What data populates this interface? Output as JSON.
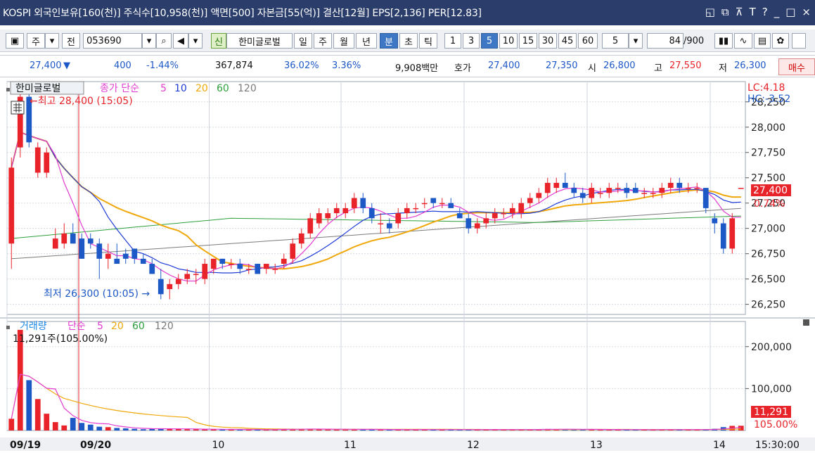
{
  "title": {
    "text": "KOSPI 외국인보유[160(천)] 주식수[10,958(천)] 액면[500] 자본금[55(억)] 결산[12월] EPS[2,136] PER[12.83]",
    "controls": [
      "?",
      "_",
      "□",
      "×"
    ]
  },
  "toolbar": {
    "market": "주",
    "category": "전",
    "code": "053690",
    "stock_name": "한미글로벌",
    "shin": "신",
    "periods": [
      "일",
      "주",
      "월",
      "년",
      "분",
      "초",
      "틱"
    ],
    "active_period": "분",
    "intervals": [
      "1",
      "3",
      "5",
      "10",
      "15",
      "30",
      "45",
      "60"
    ],
    "active_interval": "5",
    "interval_value": "5",
    "count": "84",
    "count_total": "/900"
  },
  "quote": {
    "price": "27,400",
    "arrow": "▼",
    "change": "400",
    "change_pct": "-1.44%",
    "volume": "367,874",
    "vol_ratio": "36.02%",
    "turnover": "3.36%",
    "trade_amount": "9,908백만",
    "hoga_label": "호가",
    "ask": "27,400",
    "bid": "27,350",
    "open_label": "시",
    "open": "26,800",
    "high_label": "고",
    "high": "27,550",
    "low_label": "저",
    "low": "26,300",
    "buy_label": "매수"
  },
  "price_panel": {
    "legend": {
      "name": "한미글로벌",
      "ma_label": "종가 단순",
      "periods": [
        "5",
        "10",
        "20",
        "60",
        "120"
      ]
    },
    "max_note": "최고 28,400 (15:05)",
    "min_note": "최저 26,300 (10:05)",
    "lc": "LC:4.18",
    "hc": "HC:-3.52",
    "last_price": "27,400",
    "last_pct": "0.74%",
    "y_ticks": [
      "28,250",
      "28,000",
      "27,750",
      "27,500",
      "27,250",
      "27,000",
      "26,750",
      "26,500",
      "26,250"
    ],
    "y_values": [
      28250,
      28000,
      27750,
      27500,
      27250,
      27000,
      26750,
      26500,
      26250
    ]
  },
  "volume_panel": {
    "legend": {
      "name": "거래량",
      "ma_label": "단순",
      "periods": [
        "5",
        "20",
        "60",
        "120"
      ]
    },
    "note": "11,291주(105.00%)",
    "y_ticks": [
      "200,000",
      "100,000"
    ],
    "y_values": [
      200000,
      100000
    ],
    "last_value": "11,291",
    "last_pct": "105.00%"
  },
  "x_axis": {
    "labels": [
      "09/19",
      "09/20",
      "10",
      "11",
      "12",
      "13",
      "14",
      "15"
    ],
    "time": "15:30:00"
  },
  "colors": {
    "up": "#e8232a",
    "down": "#1d58c7",
    "ma5": "#e23bd1",
    "ma10": "#1e3ad6",
    "ma20": "#f0a80a",
    "ma60": "#2ca03c",
    "ma120": "#7a7a7a",
    "title_bg": "#2b3e6b"
  },
  "chart_data": {
    "type": "candlestick",
    "candles": [
      {
        "o": 26850,
        "h": 27700,
        "l": 26600,
        "c": 27600
      },
      {
        "o": 27800,
        "h": 28400,
        "l": 27700,
        "c": 28300
      },
      {
        "o": 28300,
        "h": 28400,
        "l": 27800,
        "c": 27850
      },
      {
        "o": 27550,
        "h": 27850,
        "l": 27500,
        "c": 27800
      },
      {
        "o": 27550,
        "h": 27800,
        "l": 27500,
        "c": 27750
      },
      {
        "o": 26800,
        "h": 27000,
        "l": 26800,
        "c": 26900
      },
      {
        "o": 26850,
        "h": 27050,
        "l": 26800,
        "c": 26950
      },
      {
        "o": 26950,
        "h": 27050,
        "l": 26850,
        "c": 26850
      },
      {
        "o": 26900,
        "h": 26950,
        "l": 26700,
        "c": 26700
      },
      {
        "o": 26900,
        "h": 26950,
        "l": 26800,
        "c": 26850
      },
      {
        "o": 26850,
        "h": 26900,
        "l": 26500,
        "c": 26700
      },
      {
        "o": 26700,
        "h": 26850,
        "l": 26600,
        "c": 26750
      },
      {
        "o": 26700,
        "h": 26850,
        "l": 26650,
        "c": 26650
      },
      {
        "o": 26750,
        "h": 26800,
        "l": 26650,
        "c": 26700
      },
      {
        "o": 26800,
        "h": 26800,
        "l": 26650,
        "c": 26700
      },
      {
        "o": 26700,
        "h": 26750,
        "l": 26650,
        "c": 26650
      },
      {
        "o": 26650,
        "h": 26700,
        "l": 26550,
        "c": 26550
      },
      {
        "o": 26500,
        "h": 26600,
        "l": 26300,
        "c": 26350
      },
      {
        "o": 26400,
        "h": 26500,
        "l": 26300,
        "c": 26450
      },
      {
        "o": 26450,
        "h": 26550,
        "l": 26400,
        "c": 26500
      },
      {
        "o": 26500,
        "h": 26600,
        "l": 26450,
        "c": 26550
      },
      {
        "o": 26550,
        "h": 26600,
        "l": 26450,
        "c": 26550
      },
      {
        "o": 26500,
        "h": 26700,
        "l": 26450,
        "c": 26650
      },
      {
        "o": 26600,
        "h": 26700,
        "l": 26550,
        "c": 26700
      },
      {
        "o": 26700,
        "h": 26700,
        "l": 26600,
        "c": 26650
      },
      {
        "o": 26650,
        "h": 26700,
        "l": 26600,
        "c": 26650
      },
      {
        "o": 26650,
        "h": 26700,
        "l": 26550,
        "c": 26600
      },
      {
        "o": 26600,
        "h": 26650,
        "l": 26550,
        "c": 26600
      },
      {
        "o": 26650,
        "h": 26650,
        "l": 26550,
        "c": 26550
      },
      {
        "o": 26600,
        "h": 26650,
        "l": 26550,
        "c": 26650
      },
      {
        "o": 26600,
        "h": 26650,
        "l": 26550,
        "c": 26600
      },
      {
        "o": 26650,
        "h": 26750,
        "l": 26600,
        "c": 26700
      },
      {
        "o": 26700,
        "h": 26900,
        "l": 26650,
        "c": 26850
      },
      {
        "o": 26850,
        "h": 27000,
        "l": 26800,
        "c": 26950
      },
      {
        "o": 26950,
        "h": 27150,
        "l": 26900,
        "c": 27100
      },
      {
        "o": 27050,
        "h": 27200,
        "l": 27000,
        "c": 27150
      },
      {
        "o": 27100,
        "h": 27200,
        "l": 27050,
        "c": 27150
      },
      {
        "o": 27150,
        "h": 27250,
        "l": 27100,
        "c": 27200
      },
      {
        "o": 27150,
        "h": 27250,
        "l": 27100,
        "c": 27200
      },
      {
        "o": 27200,
        "h": 27350,
        "l": 27150,
        "c": 27300
      },
      {
        "o": 27300,
        "h": 27350,
        "l": 27150,
        "c": 27200
      },
      {
        "o": 27200,
        "h": 27250,
        "l": 27050,
        "c": 27100
      },
      {
        "o": 27050,
        "h": 27150,
        "l": 26950,
        "c": 27050
      },
      {
        "o": 27050,
        "h": 27100,
        "l": 26950,
        "c": 27000
      },
      {
        "o": 27050,
        "h": 27200,
        "l": 27000,
        "c": 27150
      },
      {
        "o": 27150,
        "h": 27250,
        "l": 27100,
        "c": 27200
      },
      {
        "o": 27200,
        "h": 27250,
        "l": 27150,
        "c": 27200
      },
      {
        "o": 27250,
        "h": 27300,
        "l": 27200,
        "c": 27250
      },
      {
        "o": 27300,
        "h": 27300,
        "l": 27200,
        "c": 27250
      },
      {
        "o": 27250,
        "h": 27300,
        "l": 27200,
        "c": 27250
      },
      {
        "o": 27250,
        "h": 27300,
        "l": 27200,
        "c": 27200
      },
      {
        "o": 27150,
        "h": 27200,
        "l": 27100,
        "c": 27100
      },
      {
        "o": 27100,
        "h": 27150,
        "l": 26950,
        "c": 27000
      },
      {
        "o": 27000,
        "h": 27100,
        "l": 26950,
        "c": 27050
      },
      {
        "o": 27050,
        "h": 27150,
        "l": 27000,
        "c": 27100
      },
      {
        "o": 27100,
        "h": 27200,
        "l": 27050,
        "c": 27150
      },
      {
        "o": 27150,
        "h": 27200,
        "l": 27100,
        "c": 27150
      },
      {
        "o": 27150,
        "h": 27250,
        "l": 27100,
        "c": 27200
      },
      {
        "o": 27150,
        "h": 27300,
        "l": 27100,
        "c": 27250
      },
      {
        "o": 27250,
        "h": 27350,
        "l": 27200,
        "c": 27300
      },
      {
        "o": 27300,
        "h": 27400,
        "l": 27250,
        "c": 27350
      },
      {
        "o": 27350,
        "h": 27500,
        "l": 27300,
        "c": 27450
      },
      {
        "o": 27400,
        "h": 27500,
        "l": 27350,
        "c": 27450
      },
      {
        "o": 27450,
        "h": 27550,
        "l": 27400,
        "c": 27400
      },
      {
        "o": 27400,
        "h": 27450,
        "l": 27300,
        "c": 27350
      },
      {
        "o": 27350,
        "h": 27400,
        "l": 27250,
        "c": 27300
      },
      {
        "o": 27300,
        "h": 27450,
        "l": 27250,
        "c": 27400
      },
      {
        "o": 27350,
        "h": 27400,
        "l": 27300,
        "c": 27350
      },
      {
        "o": 27350,
        "h": 27450,
        "l": 27300,
        "c": 27400
      },
      {
        "o": 27400,
        "h": 27450,
        "l": 27350,
        "c": 27400
      },
      {
        "o": 27400,
        "h": 27450,
        "l": 27300,
        "c": 27350
      },
      {
        "o": 27400,
        "h": 27450,
        "l": 27350,
        "c": 27350
      },
      {
        "o": 27350,
        "h": 27400,
        "l": 27300,
        "c": 27350
      },
      {
        "o": 27350,
        "h": 27400,
        "l": 27300,
        "c": 27350
      },
      {
        "o": 27350,
        "h": 27450,
        "l": 27300,
        "c": 27400
      },
      {
        "o": 27400,
        "h": 27500,
        "l": 27350,
        "c": 27450
      },
      {
        "o": 27450,
        "h": 27500,
        "l": 27350,
        "c": 27400
      },
      {
        "o": 27400,
        "h": 27450,
        "l": 27350,
        "c": 27400
      },
      {
        "o": 27400,
        "h": 27450,
        "l": 27350,
        "c": 27400
      },
      {
        "o": 27400,
        "h": 27400,
        "l": 27150,
        "c": 27200
      },
      {
        "o": 27100,
        "h": 27150,
        "l": 26950,
        "c": 27050
      },
      {
        "o": 27050,
        "h": 27100,
        "l": 26750,
        "c": 26800
      },
      {
        "o": 26800,
        "h": 27150,
        "l": 26750,
        "c": 27100
      },
      {
        "o": 27400,
        "h": 27400,
        "l": 27400,
        "c": 27400
      }
    ],
    "volumes": [
      28000,
      240000,
      120000,
      75000,
      40000,
      20000,
      12000,
      30000,
      18000,
      14000,
      9000,
      8000,
      6000,
      5000,
      4000,
      3000,
      4000,
      5000,
      4000,
      3500,
      3000,
      3000,
      2500,
      2800,
      3000,
      2500,
      2000,
      2500,
      2200,
      2000,
      2400,
      4000,
      3500,
      3000,
      3500,
      3000,
      2800,
      2500,
      3000,
      2800,
      2500,
      2200,
      2000,
      2500,
      2400,
      2200,
      2000,
      2500,
      2200,
      2000,
      2100,
      2400,
      2500,
      2300,
      2000,
      2200,
      2100,
      2000,
      2400,
      2500,
      3000,
      3500,
      3000,
      2800,
      2500,
      2400,
      2600,
      2300,
      2200,
      2000,
      2100,
      2200,
      2000,
      2000,
      2300,
      2400,
      2100,
      2000,
      2000,
      2500,
      4000,
      8000,
      11000,
      11291
    ],
    "y_range": [
      26150,
      28450
    ],
    "volume_range": [
      0,
      260000
    ],
    "day_starts": [
      0,
      8,
      23,
      38,
      52,
      66,
      80
    ],
    "grid": true
  }
}
